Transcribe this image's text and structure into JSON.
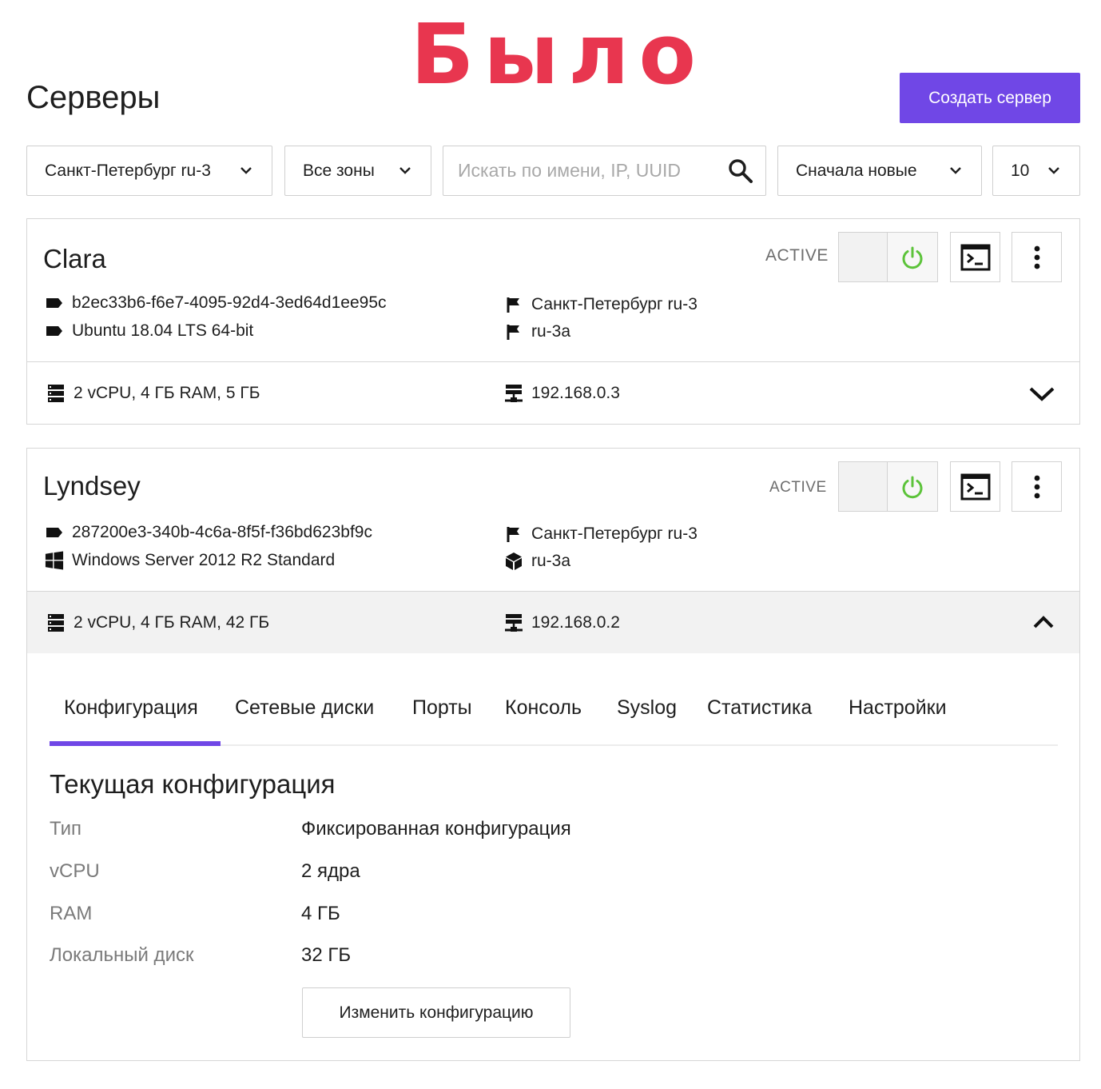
{
  "banner": "Было",
  "page": {
    "title": "Серверы",
    "create_button": "Создать сервер"
  },
  "filters": {
    "region": "Санкт-Петербург ru-3",
    "zone": "Все зоны",
    "search_placeholder": "Искать по имени, IP, UUID",
    "sort": "Сначала новые",
    "per_page": "10"
  },
  "colors": {
    "accent": "#7047e6",
    "banner": "#e8364f",
    "power": "#5cc33a"
  },
  "servers": [
    {
      "name": "Clara",
      "status": "ACTIVE",
      "uuid": "b2ec33b6-f6e7-4095-92d4-3ed64d1ee95c",
      "os": "Ubuntu 18.04 LTS 64-bit",
      "os_icon": "tag-icon",
      "region": "Санкт-Петербург ru-3",
      "zone": "ru-3a",
      "zone_icon": "flag-icon",
      "flavor": "2 vCPU, 4 ГБ RAM, 5 ГБ",
      "ip": "192.168.0.3",
      "expanded": false
    },
    {
      "name": "Lyndsey",
      "status": "ACTIVE",
      "uuid": "287200e3-340b-4c6a-8f5f-f36bd623bf9c",
      "os": "Windows Server 2012 R2 Standard",
      "os_icon": "windows-icon",
      "region": "Санкт-Петербург ru-3",
      "zone": "ru-3a",
      "zone_icon": "cube-icon",
      "flavor": "2 vCPU, 4 ГБ RAM, 42 ГБ",
      "ip": "192.168.0.2",
      "expanded": true
    }
  ],
  "details": {
    "tabs": [
      "Конфигурация",
      "Сетевые диски",
      "Порты",
      "Консоль",
      "Syslog",
      "Статистика",
      "Настройки"
    ],
    "active_tab": "Конфигурация",
    "section_title": "Текущая конфигурация",
    "config": [
      {
        "label": "Тип",
        "value": "Фиксированная конфигурация"
      },
      {
        "label": "vCPU",
        "value": "2 ядра"
      },
      {
        "label": "RAM",
        "value": "4 ГБ"
      },
      {
        "label": "Локальный диск",
        "value": "32 ГБ"
      }
    ],
    "change_button": "Изменить конфигурацию"
  }
}
